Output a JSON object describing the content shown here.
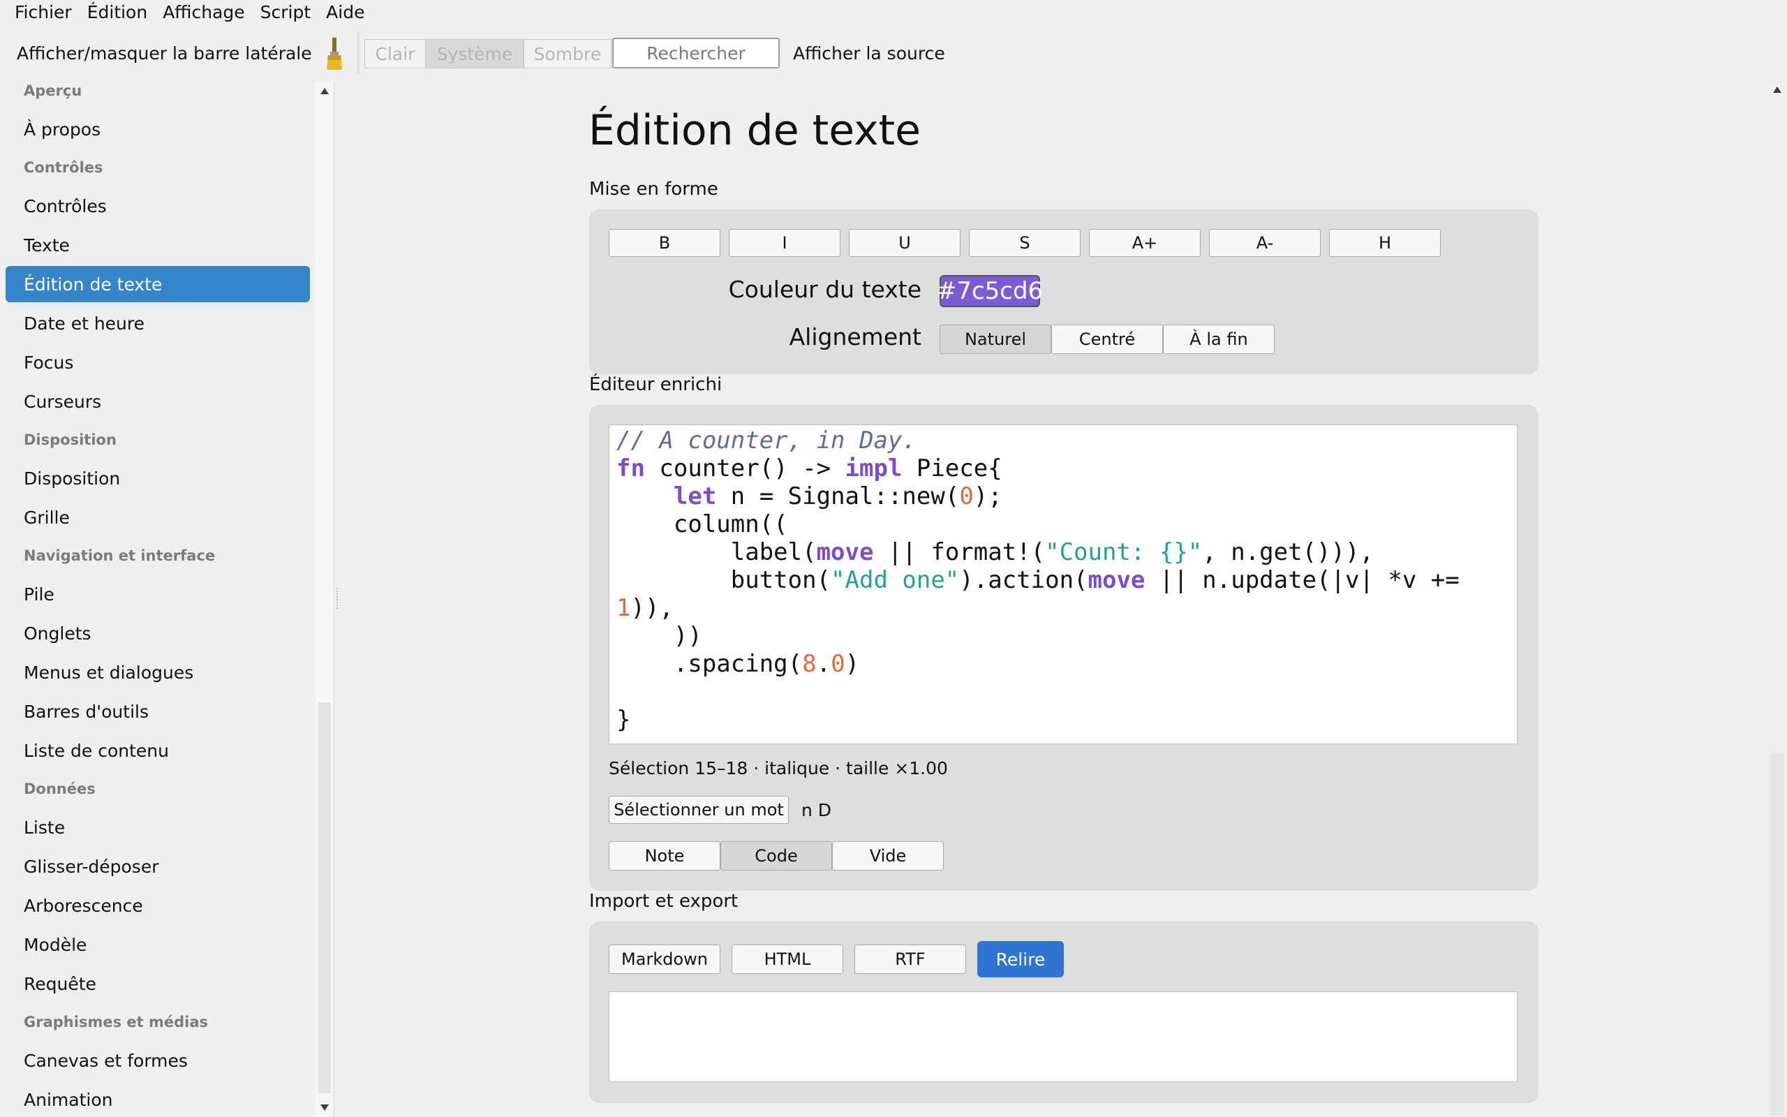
{
  "menubar": [
    "Fichier",
    "Édition",
    "Affichage",
    "Script",
    "Aide"
  ],
  "toolbar": {
    "sidebar_toggle": "Afficher/masquer la barre latérale",
    "brush_icon": "paintbrush-icon",
    "theme_buttons": [
      "Clair",
      "Système",
      "Sombre"
    ],
    "theme_selected": "Système",
    "search_placeholder": "Rechercher",
    "show_source": "Afficher la source"
  },
  "sidebar": {
    "selected": "Édition de texte",
    "sections": [
      {
        "title": "Aperçu",
        "items": [
          "À propos"
        ]
      },
      {
        "title": "Contrôles",
        "items": [
          "Contrôles",
          "Texte",
          "Édition de texte",
          "Date et heure",
          "Focus",
          "Curseurs"
        ]
      },
      {
        "title": "Disposition",
        "items": [
          "Disposition",
          "Grille"
        ]
      },
      {
        "title": "Navigation et interface",
        "items": [
          "Pile",
          "Onglets",
          "Menus et dialogues",
          "Barres d'outils",
          "Liste de contenu"
        ]
      },
      {
        "title": "Données",
        "items": [
          "Liste",
          "Glisser-déposer",
          "Arborescence",
          "Modèle",
          "Requête"
        ]
      },
      {
        "title": "Graphismes et médias",
        "items": [
          "Canevas et formes",
          "Animation"
        ]
      }
    ]
  },
  "main": {
    "title": "Édition de texte",
    "formatting": {
      "section_label": "Mise en forme",
      "buttons": [
        "B",
        "I",
        "U",
        "S",
        "A+",
        "A-",
        "H"
      ],
      "color_label": "Couleur du texte",
      "color_value": "#7c5cd6",
      "align_label": "Alignement",
      "align_options": [
        "Naturel",
        "Centré",
        "À la fin"
      ],
      "align_selected": "Naturel"
    },
    "rich_editor": {
      "section_label": "Éditeur enrichi",
      "code_lines": [
        [
          {
            "t": "// A counter, in Day.",
            "c": "cm"
          }
        ],
        [
          {
            "t": "fn",
            "c": "kw"
          },
          {
            "t": " counter() -> "
          },
          {
            "t": "impl",
            "c": "kw"
          },
          {
            "t": " Piece{"
          }
        ],
        [
          {
            "t": "    "
          },
          {
            "t": "let",
            "c": "kw"
          },
          {
            "t": " n = Signal::new("
          },
          {
            "t": "0",
            "c": "nm"
          },
          {
            "t": ");"
          }
        ],
        [
          {
            "t": "    column(("
          }
        ],
        [
          {
            "t": "        label("
          },
          {
            "t": "move",
            "c": "kw"
          },
          {
            "t": " || format!("
          },
          {
            "t": "\"Count: {}\"",
            "c": "st"
          },
          {
            "t": ", n.get())),"
          }
        ],
        [
          {
            "t": "        button("
          },
          {
            "t": "\"Add one\"",
            "c": "st"
          },
          {
            "t": ").action("
          },
          {
            "t": "move",
            "c": "kw"
          },
          {
            "t": " || n.update(|v| *v +="
          }
        ],
        [
          {
            "t": "1",
            "c": "nm"
          },
          {
            "t": ")),"
          }
        ],
        [
          {
            "t": "    ))"
          }
        ],
        [
          {
            "t": "    .spacing("
          },
          {
            "t": "8",
            "c": "nm"
          },
          {
            "t": "."
          },
          {
            "t": "0",
            "c": "nm"
          },
          {
            "t": ")"
          }
        ],
        [
          {
            "t": ""
          }
        ],
        [
          {
            "t": "}"
          }
        ]
      ],
      "status": "Sélection 15–18 · italique · taille ×1.00",
      "select_word_button": "Sélectionner un mot",
      "word_info": "n D",
      "mode_buttons": [
        "Note",
        "Code",
        "Vide"
      ],
      "mode_selected": "Code"
    },
    "import_export": {
      "section_label": "Import et export",
      "buttons": [
        "Markdown",
        "HTML",
        "RTF"
      ],
      "reload_button": "Relire",
      "output_text": ""
    }
  }
}
